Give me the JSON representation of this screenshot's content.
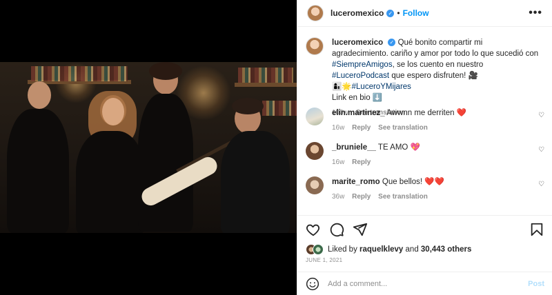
{
  "post": {
    "username": "luceromexico",
    "follow_label": "Follow",
    "more_label": "•••"
  },
  "caption": {
    "username": "luceromexico",
    "text_1": "Qué bonito compartir mi agradecimiento. cariño y amor por todo lo que sucedió con ",
    "tag_1": "#SiempreAmigos",
    "text_2": ", se los cuento en nuestro ",
    "tag_2": "#LuceroPodcast",
    "text_3": " que espero disfruten! 🎥",
    "line_emoji": "👩‍👦🌟",
    "tag_3": "#LuceroYMijares",
    "link_line": "Link en bio ⬇️",
    "time": "100w",
    "see_translation": "See translation"
  },
  "comments": [
    {
      "username": "elin.martinez_",
      "text": "Awwnn me derriten",
      "emoji": "❤️",
      "time": "16w",
      "reply": "Reply",
      "see_translation": "See translation"
    },
    {
      "username": "_bruniele__",
      "text": "TE AMO",
      "emoji": "💖",
      "time": "16w",
      "reply": "Reply",
      "see_translation": ""
    },
    {
      "username": "marite_romo",
      "text": "Que bellos!",
      "emoji": "❤️❤️",
      "time": "36w",
      "reply": "Reply",
      "see_translation": "See translation"
    }
  ],
  "likes": {
    "prefix": "Liked by ",
    "user": "raquelklevy",
    "middle": " and ",
    "count": "30,443 others"
  },
  "date": "JUNE 1, 2021",
  "add_comment": {
    "placeholder": "Add a comment...",
    "post_label": "Post"
  },
  "colors": {
    "accent": "#0095f6",
    "verified": "#3897f0",
    "tag": "#00376b",
    "muted": "#8e8e8e",
    "heart": "#ed4956"
  },
  "icons": [
    "verified-icon",
    "more-icon",
    "heart-icon",
    "comment-icon",
    "share-icon",
    "bookmark-icon",
    "emoji-icon",
    "comment-like-icon"
  ]
}
